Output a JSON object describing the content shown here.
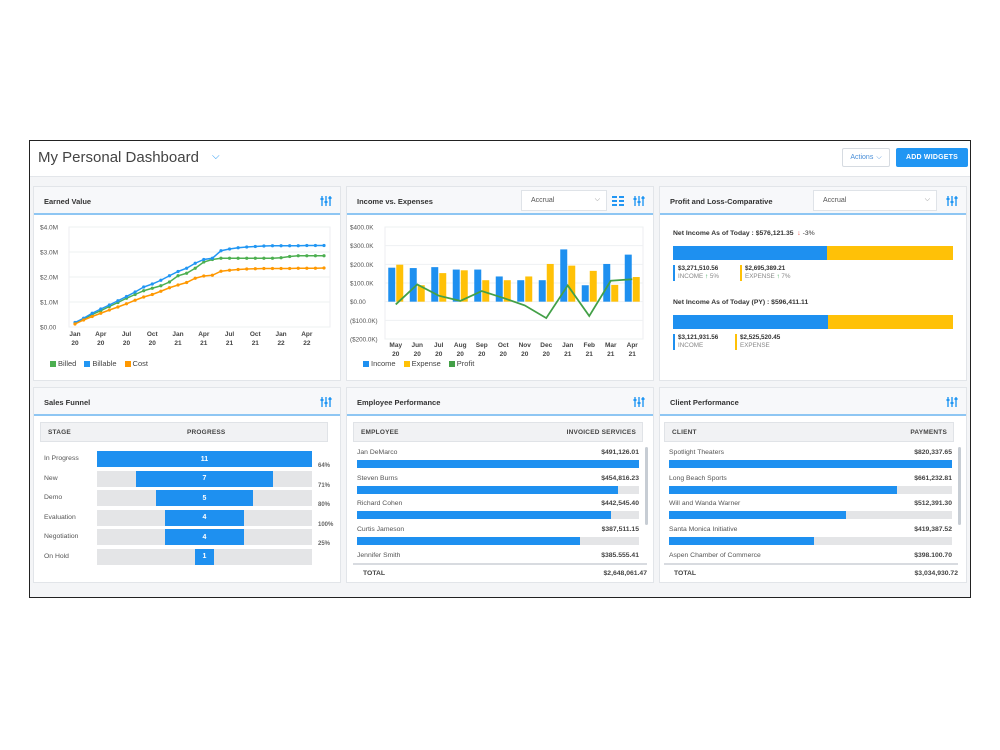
{
  "header": {
    "title": "My Personal Dashboard",
    "actions_label": "Actions",
    "add_widgets_label": "ADD WIDGETS"
  },
  "colors": {
    "accent": "#2196f3",
    "income": "#1e90f0",
    "expense": "#ffc107",
    "profit": "#43a047",
    "billed": "#4caf50",
    "billable": "#2196f3",
    "cost": "#ff9800"
  },
  "earned_value": {
    "title": "Earned Value",
    "icon": "sliders-icon"
  },
  "income_expenses": {
    "title": "Income vs. Expenses",
    "select_value": "Accrual",
    "icons": [
      "list-view-icon",
      "sliders-icon"
    ]
  },
  "profit_loss": {
    "title": "Profit and Loss-Comparative",
    "select_value": "Accrual",
    "current": {
      "label": "Net Income As of Today : $576,121.35",
      "change": "-3%",
      "income_value": "$3,271,510.56",
      "income_label": "INCOME",
      "income_change": "5%",
      "expense_value": "$2,695,389.21",
      "expense_label": "EXPENSE",
      "expense_change": "7%",
      "income_share": 0.55
    },
    "previous": {
      "label": "Net Income As of Today (PY) : $596,411.11",
      "income_value": "$3,121,931.56",
      "income_label": "INCOME",
      "expense_value": "$2,525,520.45",
      "expense_label": "EXPENSE",
      "income_share": 0.553
    }
  },
  "sales_funnel": {
    "title": "Sales Funnel",
    "col_stage": "STAGE",
    "col_progress": "PROGRESS",
    "max": 11,
    "stages": [
      {
        "label": "In Progress",
        "count": "11",
        "value": 11
      },
      {
        "label": "New",
        "count": "7",
        "value": 7
      },
      {
        "label": "Demo",
        "count": "5",
        "value": 5
      },
      {
        "label": "Evaluation",
        "count": "4",
        "value": 4
      },
      {
        "label": "Negotiation",
        "count": "4",
        "value": 4
      },
      {
        "label": "On Hold",
        "count": "1",
        "value": 1
      }
    ],
    "conversions": [
      "64%",
      "71%",
      "80%",
      "100%",
      "25%"
    ]
  },
  "employee_performance": {
    "title": "Employee Performance",
    "col_left": "EMPLOYEE",
    "col_right": "INVOICED SERVICES",
    "rows": [
      {
        "name": "Jan DeMarco",
        "value": "$491,126.01",
        "amount": 491126.01
      },
      {
        "name": "Steven Burns",
        "value": "$454,816.23",
        "amount": 454816.23
      },
      {
        "name": "Richard Cohen",
        "value": "$442,545.40",
        "amount": 442545.4
      },
      {
        "name": "Curtis Jameson",
        "value": "$387,511.15",
        "amount": 387511.15
      },
      {
        "name": "Jennifer Smith",
        "value": "$385.555.41",
        "amount": 385555.41
      }
    ],
    "total_label": "TOTAL",
    "total_value": "$2,648,061.47"
  },
  "client_performance": {
    "title": "Client Performance",
    "col_left": "CLIENT",
    "col_right": "PAYMENTS",
    "rows": [
      {
        "name": "Spotlight Theaters",
        "value": "$820,337.65",
        "amount": 820337.65
      },
      {
        "name": "Long Beach Sports",
        "value": "$661,232.81",
        "amount": 661232.81
      },
      {
        "name": "Will and Wanda Warner",
        "value": "$512,391.30",
        "amount": 512391.3
      },
      {
        "name": "Santa Monica Initiative",
        "value": "$419,387.52",
        "amount": 419387.52
      },
      {
        "name": "Aspen Chamber of Commerce",
        "value": "$398.100.70",
        "amount": 398100.7
      }
    ],
    "total_label": "TOTAL",
    "total_value": "$3,034,930.72"
  },
  "chart_data": [
    {
      "type": "line",
      "title": "Earned Value",
      "ylim": [
        0,
        4.0
      ],
      "yticks": [
        "$0.00",
        "$1.0M",
        "$2.0M",
        "$3.0M",
        "$4.0M"
      ],
      "ytick_values": [
        0,
        1,
        2,
        3,
        4
      ],
      "xtick_labels": [
        [
          "Jan",
          "20"
        ],
        [
          "Apr",
          "20"
        ],
        [
          "Jul",
          "20"
        ],
        [
          "Oct",
          "20"
        ],
        [
          "Jan",
          "21"
        ],
        [
          "Apr",
          "21"
        ],
        [
          "Jul",
          "21"
        ],
        [
          "Oct",
          "21"
        ],
        [
          "Jan",
          "22"
        ],
        [
          "Apr",
          "22"
        ]
      ],
      "xtick_positions": [
        0,
        3,
        6,
        9,
        12,
        15,
        18,
        21,
        24,
        27
      ],
      "n_points": 30,
      "legend": "bottom-left",
      "series": [
        {
          "name": "Billed",
          "color": "#4caf50",
          "values": [
            0.15,
            0.32,
            0.5,
            0.65,
            0.82,
            0.98,
            1.15,
            1.3,
            1.45,
            1.55,
            1.65,
            1.8,
            2.05,
            2.15,
            2.35,
            2.6,
            2.7,
            2.75,
            2.75,
            2.75,
            2.75,
            2.75,
            2.75,
            2.75,
            2.77,
            2.82,
            2.85,
            2.85,
            2.85,
            2.85
          ]
        },
        {
          "name": "Billable",
          "color": "#2196f3",
          "values": [
            0.18,
            0.35,
            0.55,
            0.72,
            0.88,
            1.05,
            1.22,
            1.4,
            1.6,
            1.72,
            1.87,
            2.05,
            2.22,
            2.35,
            2.55,
            2.7,
            2.75,
            3.05,
            3.12,
            3.17,
            3.2,
            3.22,
            3.24,
            3.25,
            3.25,
            3.25,
            3.25,
            3.26,
            3.26,
            3.26
          ]
        },
        {
          "name": "Cost",
          "color": "#ff9800",
          "values": [
            0.12,
            0.28,
            0.42,
            0.55,
            0.68,
            0.8,
            0.93,
            1.07,
            1.2,
            1.3,
            1.43,
            1.57,
            1.68,
            1.78,
            1.95,
            2.04,
            2.07,
            2.23,
            2.27,
            2.3,
            2.32,
            2.33,
            2.34,
            2.34,
            2.34,
            2.34,
            2.35,
            2.35,
            2.35,
            2.36
          ]
        }
      ]
    },
    {
      "type": "bar",
      "title": "Income vs. Expenses",
      "ylim": [
        -200,
        400
      ],
      "yticks": [
        "($200.0K)",
        "($100.0K)",
        "$0.00",
        "$100.0K",
        "$200.0K",
        "$300.0K",
        "$400.0K"
      ],
      "ytick_values": [
        -200,
        -100,
        0,
        100,
        200,
        300,
        400
      ],
      "categories": [
        [
          "May",
          "20"
        ],
        [
          "Jun",
          "20"
        ],
        [
          "Jul",
          "20"
        ],
        [
          "Aug",
          "20"
        ],
        [
          "Sep",
          "20"
        ],
        [
          "Oct",
          "20"
        ],
        [
          "Nov",
          "20"
        ],
        [
          "Dec",
          "20"
        ],
        [
          "Jan",
          "21"
        ],
        [
          "Feb",
          "21"
        ],
        [
          "Mar",
          "21"
        ],
        [
          "Apr",
          "21"
        ]
      ],
      "legend": "bottom-left",
      "series": [
        {
          "name": "Income",
          "color": "#1e90f0",
          "kind": "bar",
          "values": [
            182,
            180,
            185,
            172,
            172,
            135,
            115,
            115,
            280,
            88,
            202,
            252
          ]
        },
        {
          "name": "Expense",
          "color": "#ffc107",
          "kind": "bar",
          "values": [
            198,
            88,
            153,
            168,
            115,
            115,
            135,
            202,
            193,
            165,
            90,
            132
          ]
        },
        {
          "name": "Profit",
          "color": "#43a047",
          "kind": "line",
          "values": [
            -15,
            92,
            32,
            4,
            57,
            20,
            -20,
            -88,
            87,
            -77,
            112,
            120
          ]
        }
      ]
    }
  ]
}
